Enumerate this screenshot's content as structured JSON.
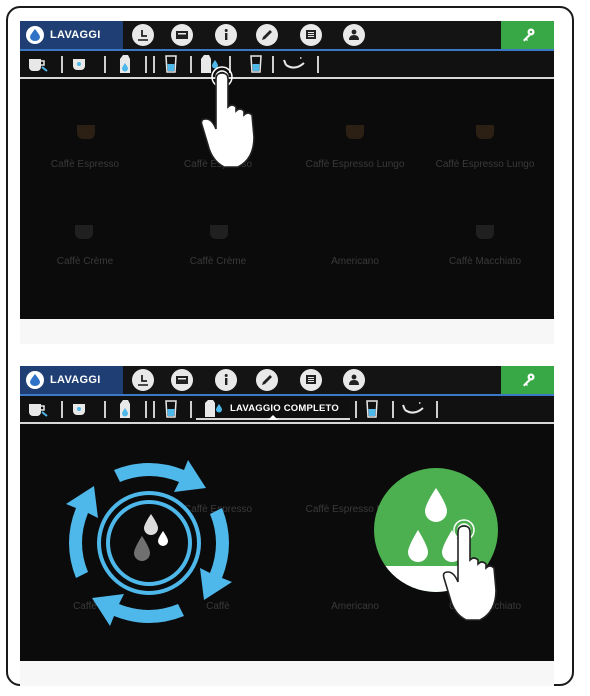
{
  "colors": {
    "accent_blue": "#1f3f74",
    "key_green": "#37a845",
    "cycle_blue": "#4fb8ea",
    "confirm_green": "#4caf50"
  },
  "topbar": {
    "mode_label": "LAVAGGI",
    "icons": [
      "lavaggi-drop-icon",
      "timer-icon",
      "card-icon",
      "info-icon",
      "edit-icon",
      "display-icon",
      "service-icon",
      "wrench-key-icon"
    ]
  },
  "subbar": {
    "icons": [
      "cup-rinse-icon",
      "cup-icon",
      "milk-carton-icon",
      "glass-icon",
      "full-wash-icon",
      "tall-glass-icon",
      "tray-clean-icon"
    ]
  },
  "full_wash": {
    "label": "LAVAGGIO COMPLETO"
  },
  "menu": {
    "row1": [
      "Caffè Espresso",
      "Caffè Espresso",
      "Caffè Espresso Lungo",
      "Caffè Espresso Lungo"
    ],
    "row2": [
      "Caffè Crème",
      "Caffè Crème",
      "Americano",
      "Caffè Macchiato"
    ]
  },
  "background_menu_2": {
    "row1": [
      "Caffè Espresso",
      "Caffè Espresso Lungo"
    ],
    "row2": [
      "Caffè",
      "Caffè",
      "Americano",
      "Caffè Macchiato"
    ]
  }
}
